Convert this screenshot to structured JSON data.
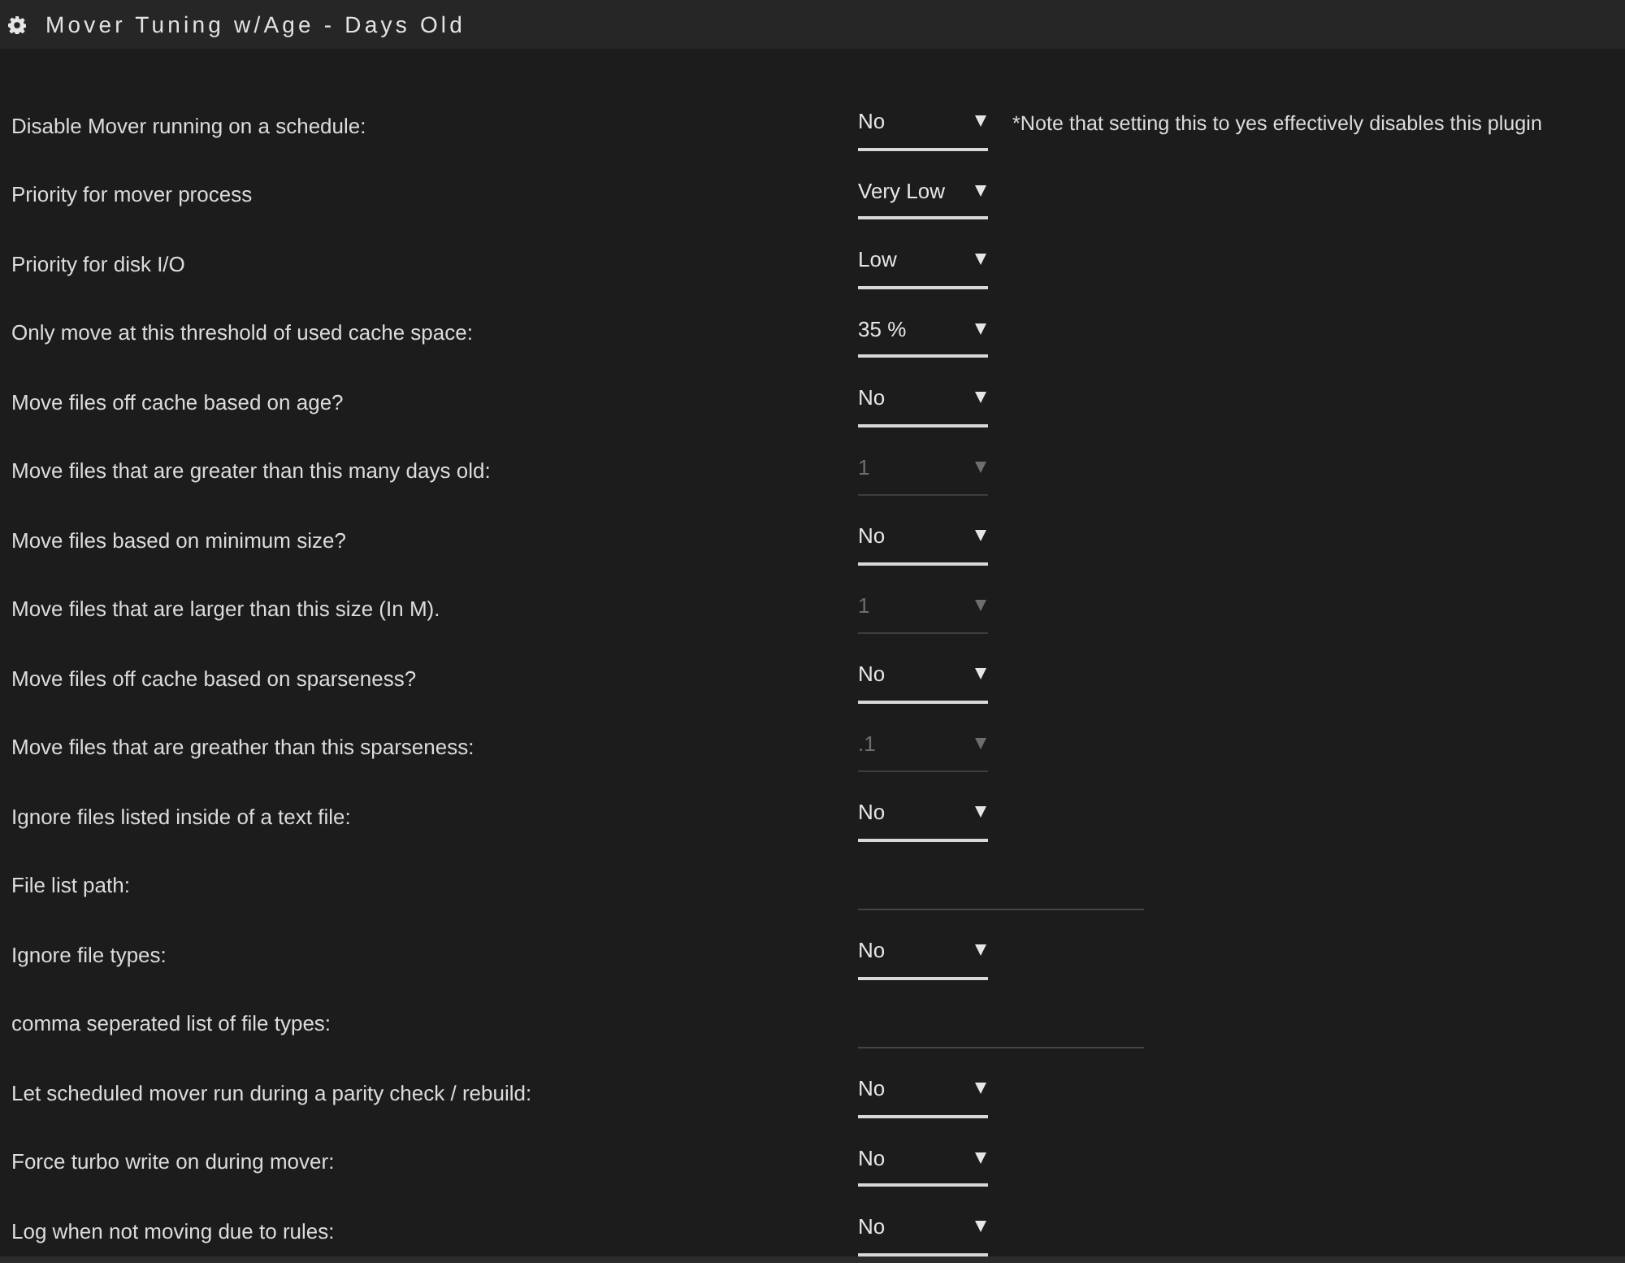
{
  "window": {
    "title": "Mover Tuning w/Age - Days Old"
  },
  "settings": [
    {
      "kind": "select",
      "label": "Disable Mover running on a schedule:",
      "value": "No",
      "disabled": false,
      "note": "*Note that setting this to yes effectively disables this plugin"
    },
    {
      "kind": "select",
      "label": "Priority for mover process",
      "value": "Very Low",
      "disabled": false
    },
    {
      "kind": "select",
      "label": "Priority for disk I/O",
      "value": "Low",
      "disabled": false
    },
    {
      "kind": "select",
      "label": "Only move at this threshold of used cache space:",
      "value": "35 %",
      "disabled": false
    },
    {
      "kind": "select",
      "label": "Move files off cache based on age?",
      "value": "No",
      "disabled": false
    },
    {
      "kind": "select",
      "label": "Move files that are greater than this many days old:",
      "value": "1",
      "disabled": true
    },
    {
      "kind": "select",
      "label": "Move files based on minimum size?",
      "value": "No",
      "disabled": false
    },
    {
      "kind": "select",
      "label": "Move files that are larger than this size (In M).",
      "value": "1",
      "disabled": true
    },
    {
      "kind": "select",
      "label": "Move files off cache based on sparseness?",
      "value": "No",
      "disabled": false
    },
    {
      "kind": "select",
      "label": "Move files that are greather than this sparseness:",
      "value": ".1",
      "disabled": true
    },
    {
      "kind": "select",
      "label": "Ignore files listed inside of a text file:",
      "value": "No",
      "disabled": false
    },
    {
      "kind": "text",
      "label": "File list path:"
    },
    {
      "kind": "select",
      "label": "Ignore file types:",
      "value": "No",
      "disabled": false
    },
    {
      "kind": "text",
      "label": "comma seperated list of file types:"
    },
    {
      "kind": "select",
      "label": "Let scheduled mover run during a parity check / rebuild:",
      "value": "No",
      "disabled": false
    },
    {
      "kind": "select",
      "label": "Force turbo write on during mover:",
      "value": "No",
      "disabled": false
    },
    {
      "kind": "select",
      "label": "Log when not moving due to rules:",
      "value": "No",
      "disabled": false
    }
  ]
}
